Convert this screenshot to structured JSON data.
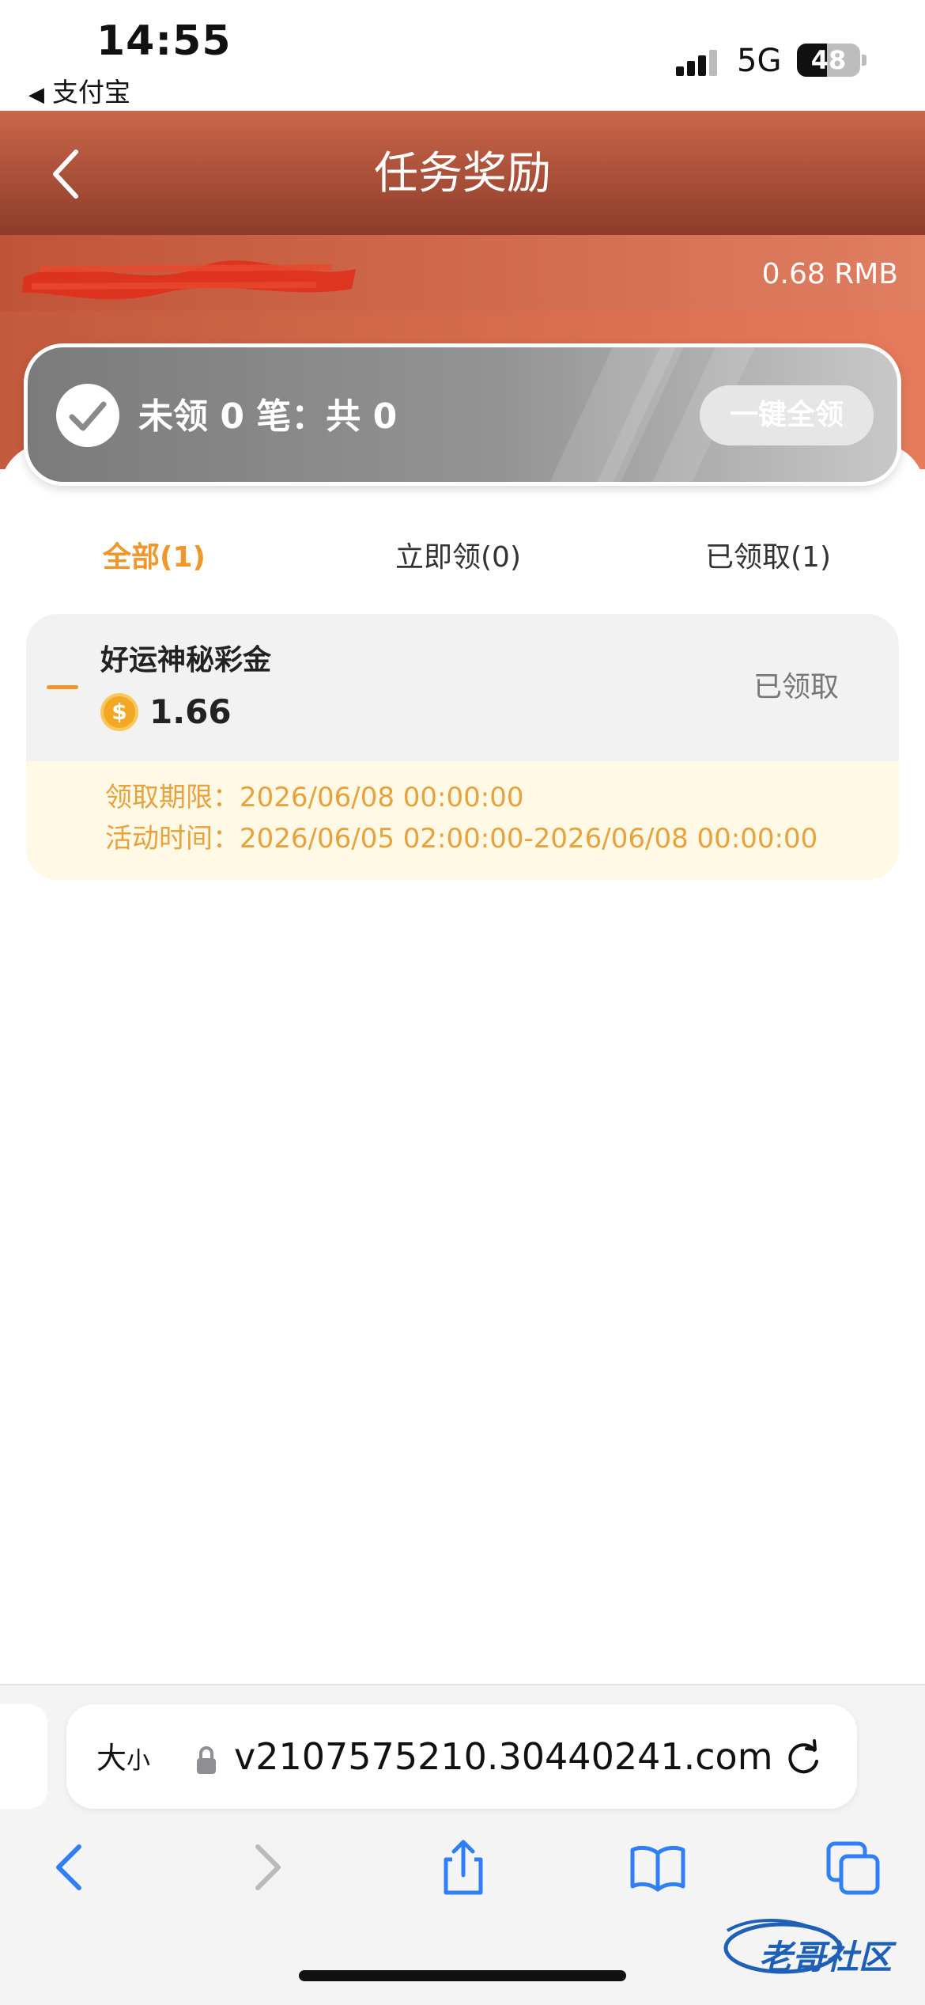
{
  "status_bar": {
    "time": "14:55",
    "back_app": "支付宝",
    "network": "5G",
    "battery": "48",
    "battery_level": 0.48
  },
  "header": {
    "title": "任务奖励"
  },
  "balance": {
    "amount": "0.68 RMB"
  },
  "claim_card": {
    "summary": "未领 0 笔：共 0",
    "claim_all_label": "一键全领"
  },
  "tabs": [
    {
      "label": "全部(1)"
    },
    {
      "label": "立即领(0)"
    },
    {
      "label": "已领取(1)"
    }
  ],
  "reward": {
    "name": "好运神秘彩金",
    "coin_symbol": "$",
    "amount": "1.66",
    "status": "已领取",
    "deadline": "领取期限：2026/06/08 00:00:00",
    "activity_time": "活动时间：2026/06/05 02:00:00-2026/06/08 00:00:00"
  },
  "browser": {
    "text_size_label": "大",
    "text_size_small": "小",
    "url": "v2107575210.30440241.com"
  },
  "watermark": {
    "text": "老哥社区"
  },
  "colors": {
    "accent": "#f0962b",
    "header": "#c9674a",
    "link_blue": "#2f7ff6"
  }
}
